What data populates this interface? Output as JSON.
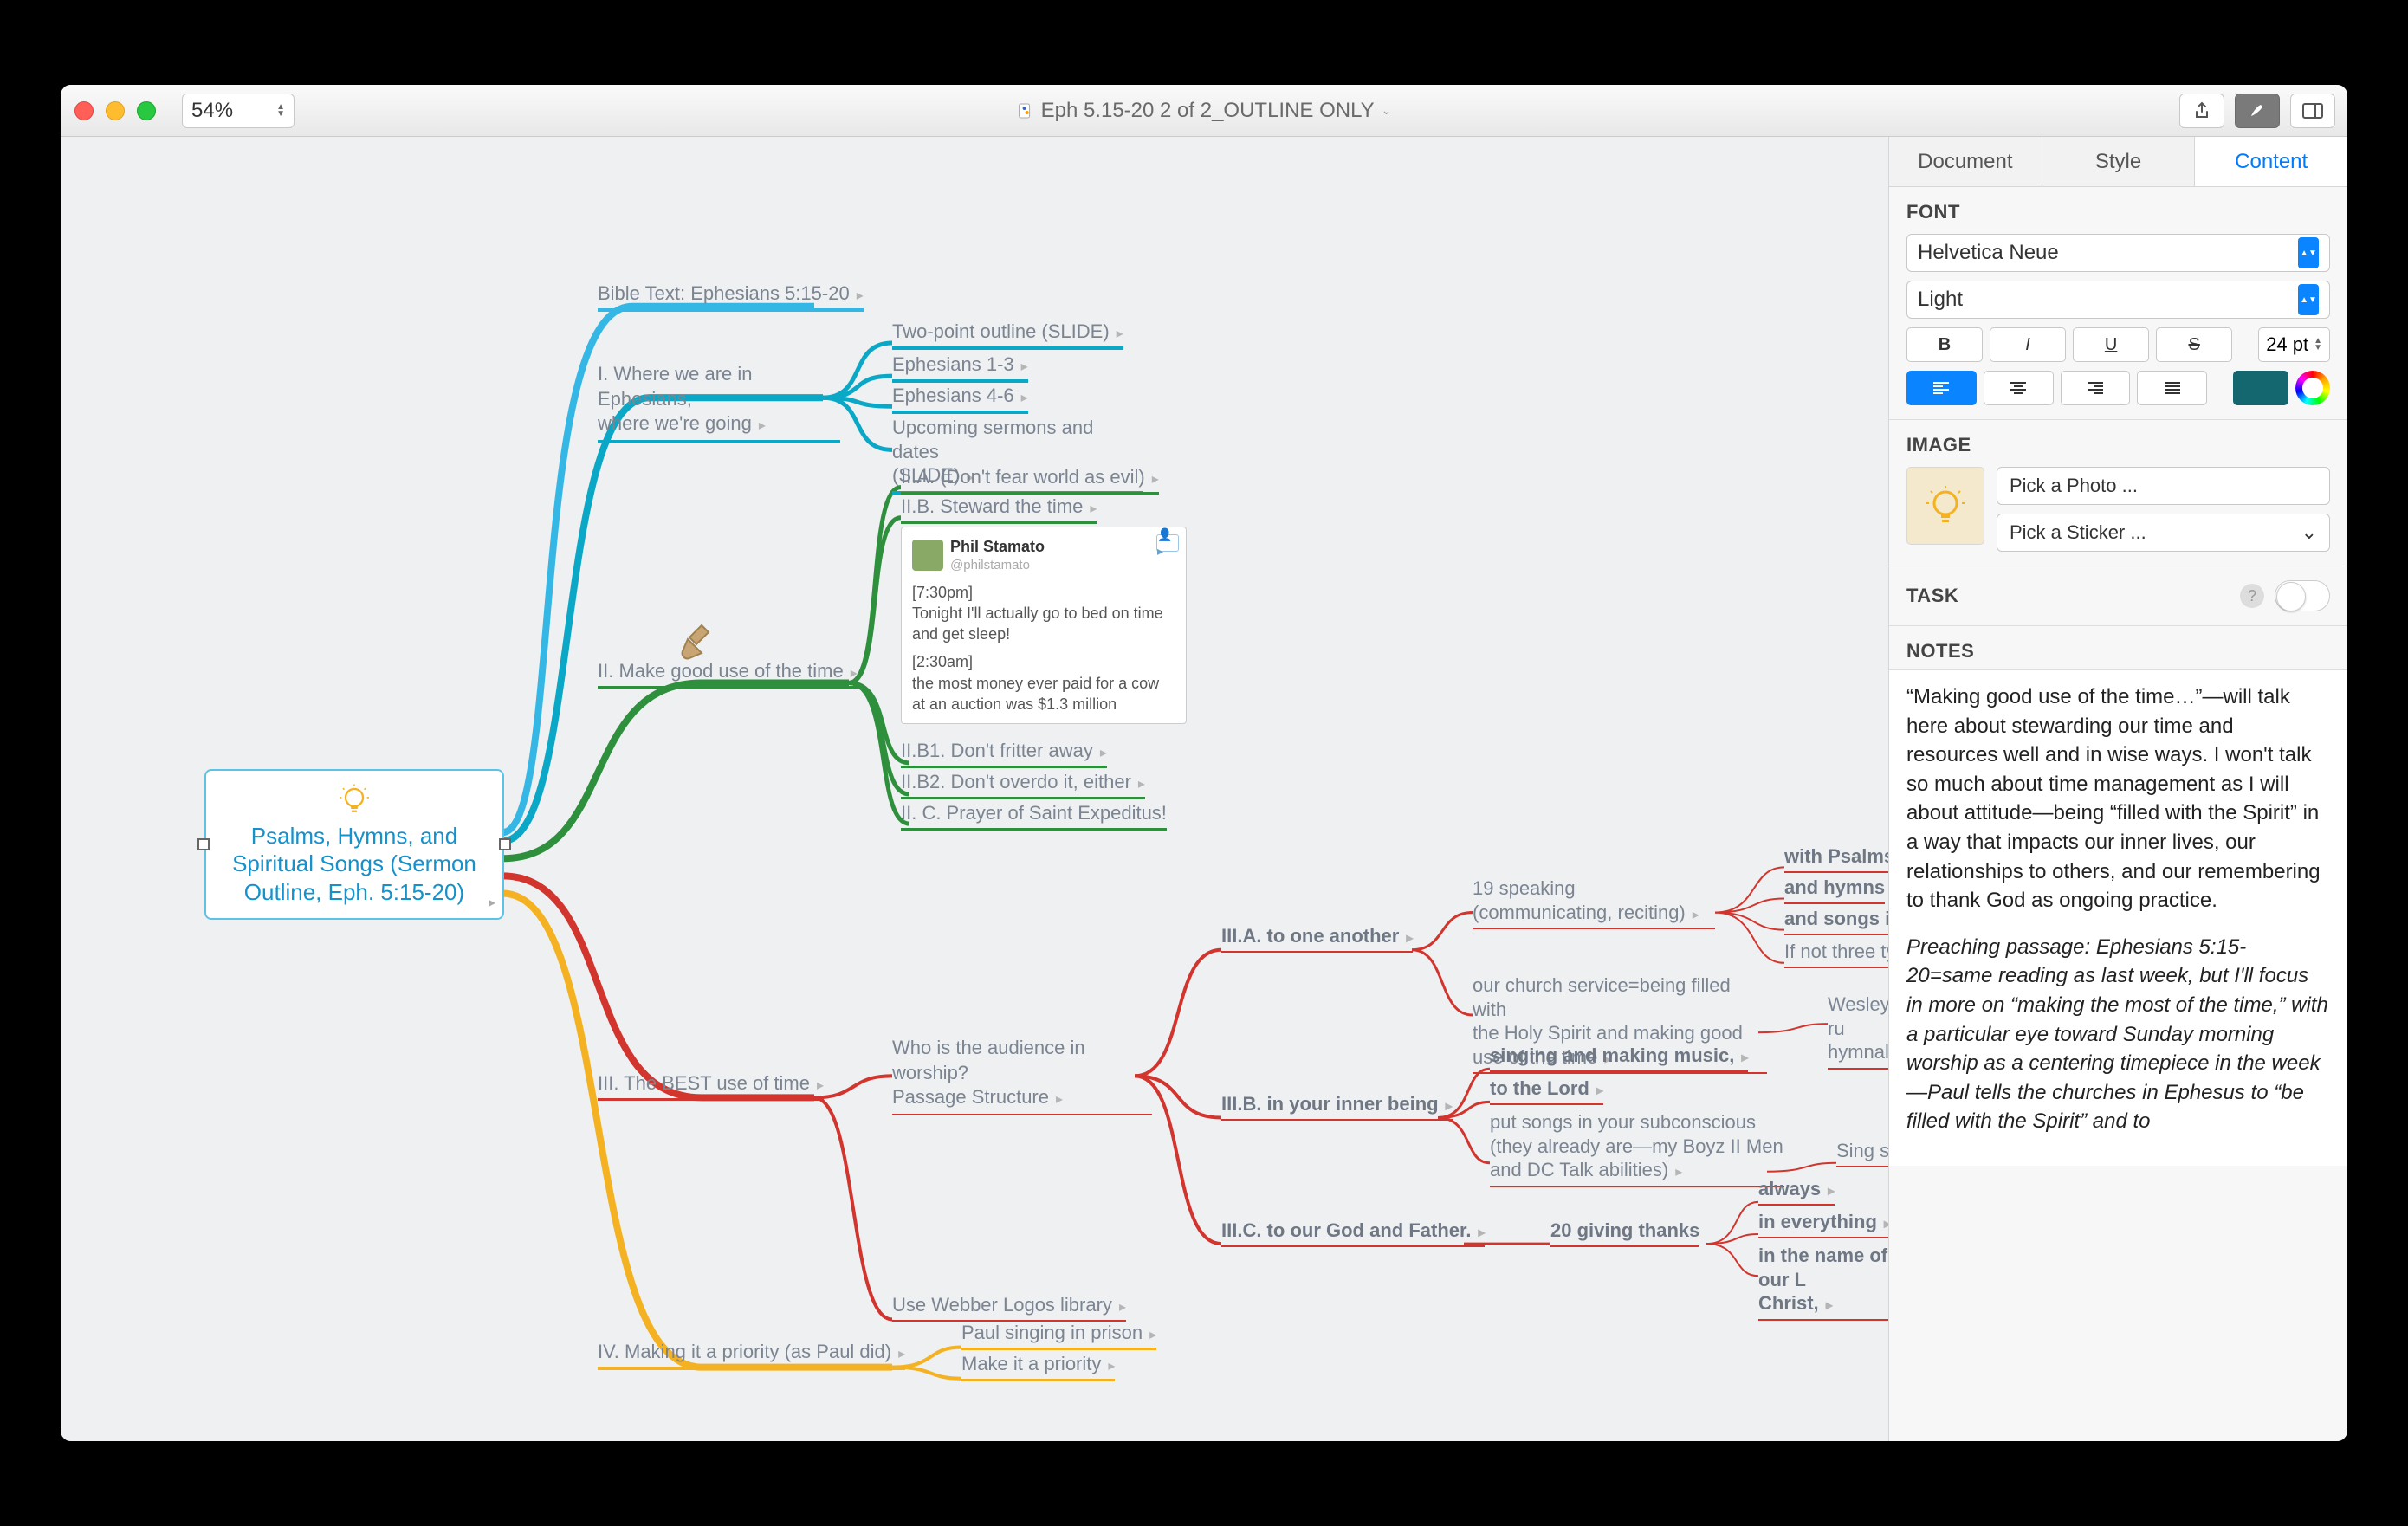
{
  "window": {
    "title": "Eph 5.15-20 2 of 2_OUTLINE ONLY",
    "zoom": "54%"
  },
  "sidebar": {
    "tabs": {
      "document": "Document",
      "style": "Style",
      "content": "Content"
    },
    "font": {
      "heading": "FONT",
      "family": "Helvetica Neue",
      "weight": "Light",
      "size": "24 pt",
      "bold": "B",
      "italic": "I",
      "underline": "U",
      "strike": "S"
    },
    "image": {
      "heading": "IMAGE",
      "pick_photo": "Pick a Photo ...",
      "pick_sticker": "Pick a Sticker ..."
    },
    "task": {
      "heading": "TASK"
    },
    "notes": {
      "heading": "NOTES",
      "p1": "“Making good use of the time…”—will talk here about stewarding our time and resources well and in wise ways. I won't talk so much about time management as I will about attitude—being “filled with the Spirit” in a way that impacts our inner lives, our relationships to others, and our remembering to thank God as ongoing practice.",
      "p2": "Preaching passage: Ephesians 5:15-20=same reading as last week, but I'll focus in more on “making the most of the time,” with a particular eye toward Sunday morning worship as a centering timepiece in the week—Paul tells the churches in Ephesus to “be filled with the Spirit” and to"
    }
  },
  "root": {
    "text": "Psalms, Hymns, and Spiritual Songs (Sermon Outline, Eph. 5:15-20)"
  },
  "nodes": {
    "n1": "Bible Text: Ephesians 5:15-20",
    "n2a": "I. Where we are in Ephesians,",
    "n2b": "where we're going",
    "n2_1": "Two-point outline (SLIDE)",
    "n2_2": "Ephesians 1-3",
    "n2_3": "Ephesians 4-6",
    "n2_4a": "Upcoming sermons and dates",
    "n2_4b": "(SLIDE)",
    "n3": "II. Make good use of the time",
    "n3_1": "II.A. (Don't fear world as evil)",
    "n3_2": "II.B. Steward the time",
    "n3_3": "II.B1. Don't fritter away",
    "n3_4": "II.B2. Don't overdo it, either",
    "n3_5": "II. C. Prayer of Saint Expeditus!",
    "card": {
      "name": "Phil Stamato",
      "handle": "@philstamato",
      "t1": "[7:30pm]",
      "p1": "Tonight I'll actually go to bed on time and get sleep!",
      "t2": "[2:30am]",
      "p2": "the most money ever paid for a cow at an auction was $1.3 million"
    },
    "n4": "III. The BEST use of time",
    "n4_qa": "Who is the audience in worship?",
    "n4_qb": "Passage Structure",
    "n4_1": "III.A. to one another",
    "n4_1_1a": "19 speaking",
    "n4_1_1b": "(communicating, reciting)",
    "n4_1_1_1": "with Psalms",
    "n4_1_1_2": "and hymns",
    "n4_1_1_3": "and songs in",
    "n4_1_1_4": "If not three ty",
    "n4_1_2a": "our church service=being filled with",
    "n4_1_2b": "the Holy Spirit and making good",
    "n4_1_2c": "use of the time",
    "n4_1_2_1a": "Wesley's ru",
    "n4_1_2_1b": "hymnal)",
    "n4_2": "III.B. in your inner being",
    "n4_2_1": "singing and making music,",
    "n4_2_2": "to the Lord",
    "n4_2_3a": "put songs in your subconscious",
    "n4_2_3b": "(they already are—my Boyz II Men",
    "n4_2_3c": "and DC Talk abilities)",
    "n4_2_3_1": "Sing son",
    "n4_3": "III.C. to our God and Father.",
    "n4_3_1": "20 giving thanks",
    "n4_3_1_1": "always",
    "n4_3_1_2": "in everything",
    "n4_3_1_3a": "in the name of our L",
    "n4_3_1_3b": "Christ,",
    "n4_4": "Use Webber Logos library",
    "n5": "IV. Making it a priority (as Paul did)",
    "n5_1": "Paul singing in prison",
    "n5_2": "Make it a priority"
  }
}
